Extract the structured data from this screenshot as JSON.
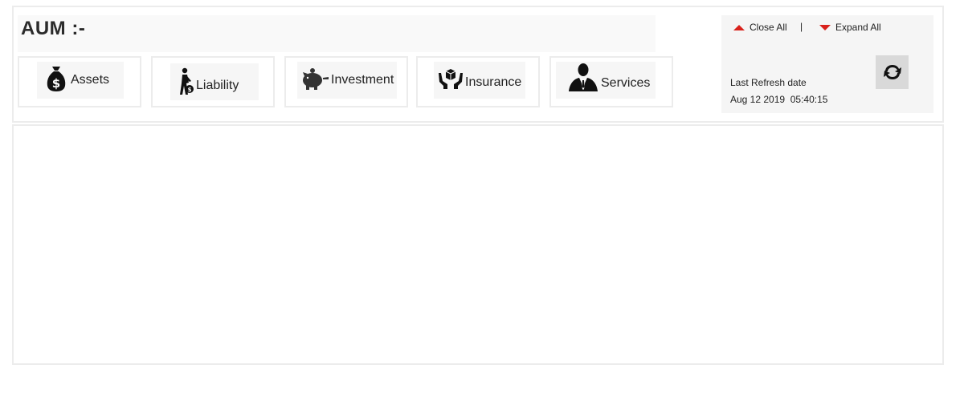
{
  "header": {
    "title": "AUM :-"
  },
  "categories": [
    {
      "label": "Assets",
      "icon": "money-bag-icon"
    },
    {
      "label": "Liability",
      "icon": "person-debt-icon"
    },
    {
      "label": "Investment",
      "icon": "piggy-bank-icon"
    },
    {
      "label": "Insurance",
      "icon": "hands-box-icon"
    },
    {
      "label": "Services",
      "icon": "businessman-icon"
    }
  ],
  "controls": {
    "close_all": "Close All",
    "separator": "|",
    "expand_all": "Expand All",
    "accent_color": "#d9221c"
  },
  "refresh": {
    "label": "Last Refresh date",
    "date": "Aug 12 2019  05:40:15",
    "icon": "refresh-icon"
  }
}
